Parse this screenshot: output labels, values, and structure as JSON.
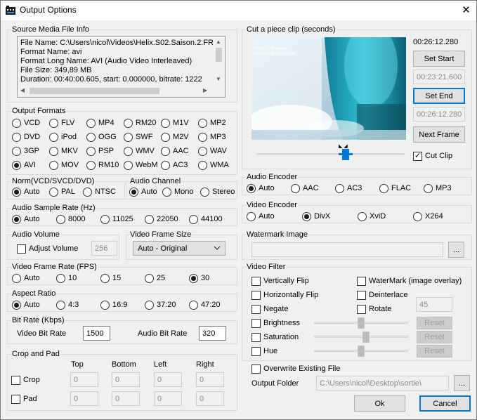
{
  "window": {
    "title": "Output Options",
    "close": "✕"
  },
  "source": {
    "label": "Source Media File Info",
    "lines": [
      "File Name: C:\\Users\\nicol\\Videos\\Helix.S02.Saison.2.FRE",
      "Format Name: avi",
      "Format Long Name: AVI (Audio Video Interleaved)",
      "File Size: 349,89 MB",
      "Duration: 00:40:00.605, start: 0.000000, bitrate: 1222"
    ]
  },
  "formats": {
    "label": "Output Formats",
    "items": [
      "VCD",
      "FLV",
      "MP4",
      "RM20",
      "M1V",
      "MP2",
      "DVD",
      "iPod",
      "OGG",
      "SWF",
      "M2V",
      "MP3",
      "3GP",
      "MKV",
      "PSP",
      "WMV",
      "AAC",
      "WAV",
      "AVI",
      "MOV",
      "RM10",
      "WebM",
      "AC3",
      "WMA"
    ],
    "selected": "AVI"
  },
  "norm": {
    "label": "Norm(VCD/SVCD/DVD)",
    "items": [
      "Auto",
      "PAL",
      "NTSC"
    ],
    "selected": "Auto"
  },
  "audio_channel": {
    "label": "Audio Channel",
    "items": [
      "Auto",
      "Mono",
      "Stereo"
    ],
    "selected": "Auto"
  },
  "sample_rate": {
    "label": "Audio Sample Rate (Hz)",
    "items": [
      "Auto",
      "8000",
      "11025",
      "22050",
      "44100"
    ],
    "selected": "Auto"
  },
  "audio_volume": {
    "label": "Audio Volume",
    "adjust_label": "Adjust Volume",
    "value": "256"
  },
  "frame_size": {
    "label": "Video Frame Size",
    "value": "Auto - Original"
  },
  "frame_rate": {
    "label": "Video Frame Rate (FPS)",
    "items": [
      "Auto",
      "10",
      "15",
      "25",
      "30"
    ],
    "selected": "30"
  },
  "aspect": {
    "label": "Aspect Ratio",
    "items": [
      "Auto",
      "4:3",
      "16:9",
      "37:20",
      "47:20"
    ],
    "selected": "Auto"
  },
  "bitrate": {
    "label": "Bit Rate (Kbps)",
    "video_label": "Video Bit Rate",
    "video_value": "1500",
    "audio_label": "Audio Bit Rate",
    "audio_value": "320"
  },
  "crop": {
    "label": "Crop and Pad",
    "cols": [
      "Top",
      "Bottom",
      "Left",
      "Right"
    ],
    "crop_label": "Crop",
    "pad_label": "Pad",
    "crop_values": [
      "0",
      "0",
      "0",
      "0"
    ],
    "pad_values": [
      "0",
      "0",
      "0",
      "0"
    ]
  },
  "cut": {
    "label": "Cut a piece clip (seconds)",
    "current_time": "00:26:12.280",
    "set_start": "Set Start",
    "start_value": "00:23:21.600",
    "set_end": "Set End",
    "end_value": "00:26:12.280",
    "next_frame": "Next Frame",
    "cut_clip_label": "Cut Clip",
    "cut_clip_checked": true,
    "position_fraction": 0.6,
    "video_caption": "00:26:12 Encours...\n00:23:21 Compression"
  },
  "audio_encoder": {
    "label": "Audio Encoder",
    "items": [
      "Auto",
      "AAC",
      "AC3",
      "FLAC",
      "MP3"
    ],
    "selected": "Auto"
  },
  "video_encoder": {
    "label": "Video Encoder",
    "items": [
      "Auto",
      "DivX",
      "XviD",
      "X264"
    ],
    "selected": "DivX"
  },
  "watermark": {
    "label": "Watermark Image",
    "value": "",
    "browse": "..."
  },
  "filter": {
    "label": "Video Filter",
    "vflip": "Vertically Flip",
    "hflip": "Horizontally Flip",
    "negate": "Negate",
    "watermark": "WaterMark (image overlay)",
    "deinterlace": "Deinterlace",
    "rotate": "Rotate",
    "rotate_value": "45",
    "brightness": "Brightness",
    "saturation": "Saturation",
    "hue": "Hue",
    "reset": "Reset",
    "brightness_level": 0.5,
    "saturation_level": 0.55,
    "hue_level": 0.5
  },
  "overwrite_label": "Overwrite Existing File",
  "output": {
    "label": "Output Folder",
    "value": "C:\\Users\\nicol\\Desktop\\sortie\\",
    "browse": "..."
  },
  "actions": {
    "ok": "Ok",
    "cancel": "Cancel"
  }
}
